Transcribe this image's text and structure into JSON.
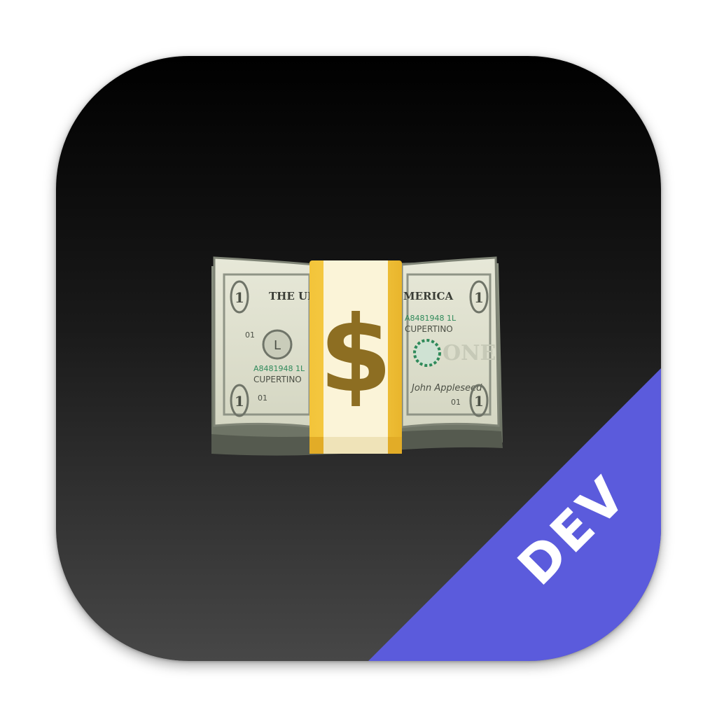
{
  "icon": {
    "name": "money-with-wings-stack",
    "badge_label": "DEV",
    "badge_color": "#5b5bdc",
    "background_top": "#000000",
    "background_bottom": "#474747"
  },
  "bill": {
    "header_left": "THE UN",
    "header_right": "MERICA",
    "serial_left": "A8481948 1L",
    "serial_right": "A8481948 1L",
    "city_left": "CUPERTINO",
    "city_right": "CUPERTINO",
    "series_left_top": "01",
    "series_left_bottom": "01",
    "series_right": "01",
    "denomination": "1",
    "signature": "John Appleseed",
    "center_mark": "$"
  }
}
